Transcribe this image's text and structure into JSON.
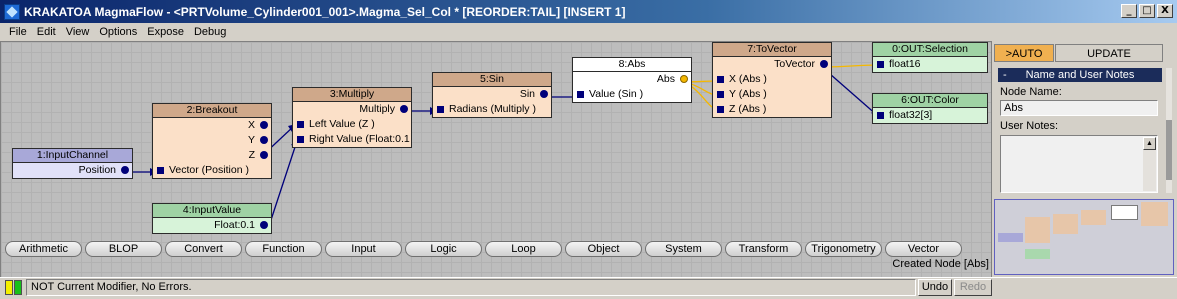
{
  "window": {
    "title": "KRAKATOA MagmaFlow - <PRTVolume_Cylinder001_001>.Magma_Sel_Col *  [REORDER:TAIL] [INSERT 1]",
    "buttons": [
      "_",
      "□",
      "X"
    ]
  },
  "menu": [
    "File",
    "Edit",
    "View",
    "Options",
    "Expose",
    "Debug"
  ],
  "nodes": {
    "input_channel": {
      "title": "1:InputChannel",
      "out": "Position"
    },
    "breakout": {
      "title": "2:Breakout",
      "outs": [
        "X",
        "Y",
        "Z"
      ],
      "in": "Vector (Position )"
    },
    "input_value": {
      "title": "4:InputValue",
      "out": "Float:0.1"
    },
    "multiply": {
      "title": "3:Multiply",
      "out": "Multiply",
      "ins": [
        "Left Value (Z )",
        "Right Value (Float:0.1"
      ]
    },
    "sin": {
      "title": "5:Sin",
      "out": "Sin",
      "in": "Radians (Multiply )"
    },
    "abs": {
      "title": "8:Abs",
      "out": "Abs",
      "in": "Value (Sin )"
    },
    "to_vector": {
      "title": "7:ToVector",
      "out": "ToVector",
      "ins": [
        "X (Abs )",
        "Y (Abs )",
        "Z (Abs )"
      ]
    },
    "out_selection": {
      "title": "0:OUT:Selection",
      "in": "float16"
    },
    "out_color": {
      "title": "6:OUT:Color",
      "in": "float32[3]"
    }
  },
  "categories": [
    "Arithmetic",
    "BLOP",
    "Convert",
    "Function",
    "Input",
    "Logic",
    "Loop",
    "Object",
    "System",
    "Transform",
    "Trigonometry",
    "Vector"
  ],
  "created_text": "Created Node [Abs]",
  "panel": {
    "tab_auto": ">AUTO",
    "tab_update": "UPDATE",
    "rollout_minus": "-",
    "rollout_title": "Name and User Notes",
    "node_name_label": "Node Name:",
    "node_name_value": "Abs",
    "user_notes_label": "User Notes:",
    "notes_scroll_up": "▲"
  },
  "status": {
    "text": "NOT Current Modifier, No Errors.",
    "undo": "Undo",
    "redo": "Redo",
    "indicator_colors": [
      "#f5f000",
      "#19c019"
    ]
  },
  "colors": {
    "active_wire": "#f5b800",
    "wire": "#00007a",
    "title_gradient_start": "#0a246a"
  }
}
